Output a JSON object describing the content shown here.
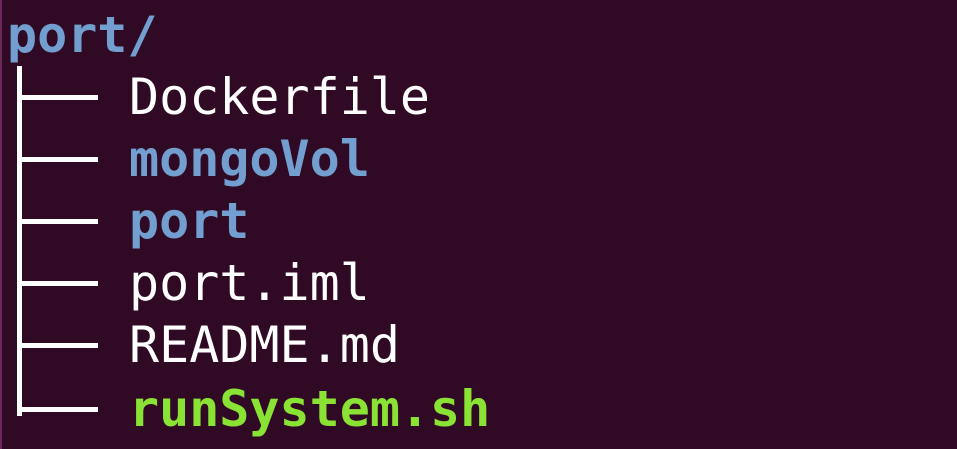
{
  "terminal": {
    "root": "port/",
    "entries": [
      {
        "name": "Dockerfile",
        "kind": "file"
      },
      {
        "name": "mongoVol",
        "kind": "dir"
      },
      {
        "name": "port",
        "kind": "dir"
      },
      {
        "name": "port.iml",
        "kind": "file"
      },
      {
        "name": "README.md",
        "kind": "file"
      },
      {
        "name": "runSystem.sh",
        "kind": "exec"
      }
    ]
  },
  "colors": {
    "background": "#300a24",
    "directory": "#729fcf",
    "executable": "#8ae234",
    "file": "#ffffff"
  }
}
